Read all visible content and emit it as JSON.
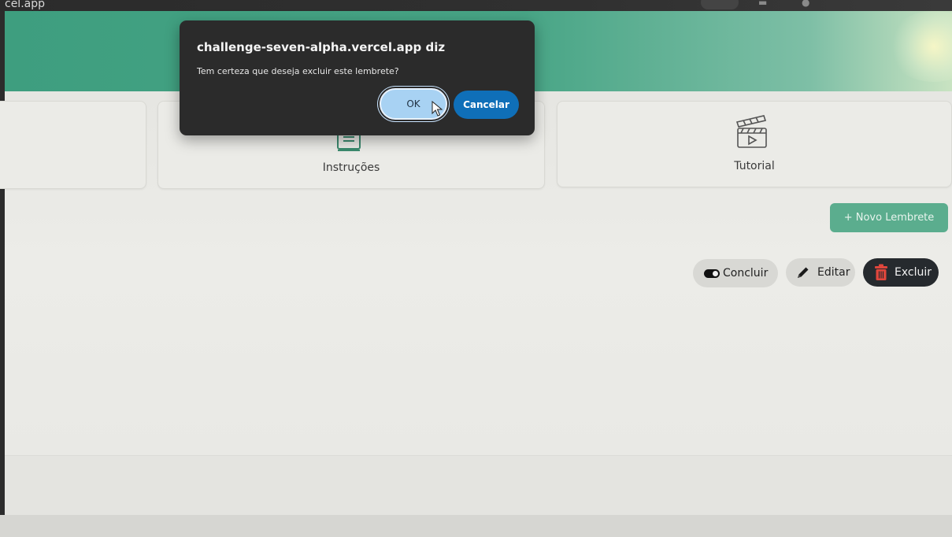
{
  "browser": {
    "url_fragment": "cel.app"
  },
  "dialog": {
    "title": "challenge-seven-alpha.vercel.app diz",
    "message": "Tem certeza que deseja excluir este lembrete?",
    "ok_label": "OK",
    "cancel_label": "Cancelar",
    "cancel_color": "#0f6fb8"
  },
  "header": {
    "color": "#48a586"
  },
  "cards": [
    {
      "label": ""
    },
    {
      "label": "Instruções",
      "icon": "book-icon"
    },
    {
      "label": "Tutorial",
      "icon": "clapperboard-icon"
    }
  ],
  "toolbar": {
    "new_reminder_label": "+ Novo Lembrete"
  },
  "reminder_actions": {
    "complete_label": "Concluir",
    "edit_label": "Editar",
    "delete_label": "Excluir"
  }
}
